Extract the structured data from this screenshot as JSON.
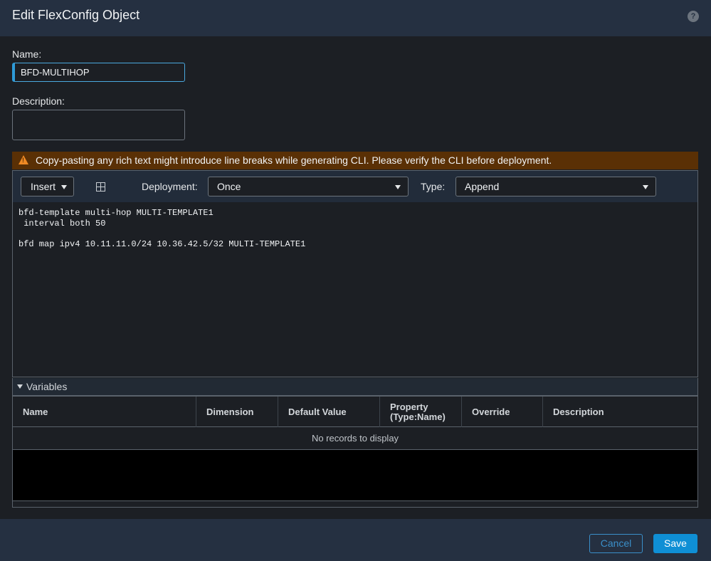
{
  "dialog": {
    "title": "Edit FlexConfig Object",
    "help_icon": "question-circle-icon",
    "help_glyph": "?"
  },
  "form": {
    "name_label": "Name:",
    "name_value": "BFD-MULTIHOP",
    "description_label": "Description:",
    "description_value": ""
  },
  "warning": {
    "icon": "warning-triangle-icon",
    "text": "Copy-pasting any rich text might introduce line breaks while generating CLI. Please verify the CLI before deployment."
  },
  "toolbar": {
    "insert_label": "Insert",
    "table_icon": "insert-table-icon",
    "deployment_label": "Deployment:",
    "deployment_value": "Once",
    "type_label": "Type:",
    "type_value": "Append"
  },
  "code": {
    "text": "bfd-template multi-hop MULTI-TEMPLATE1\n interval both 50\n\nbfd map ipv4 10.11.11.0/24 10.36.42.5/32 MULTI-TEMPLATE1"
  },
  "variables": {
    "section_label": "Variables",
    "columns": [
      "Name",
      "Dimension",
      "Default Value",
      "Property (Type:Name)",
      "Override",
      "Description"
    ],
    "empty_text": "No records to display"
  },
  "footer": {
    "cancel_label": "Cancel",
    "save_label": "Save"
  },
  "colors": {
    "accent": "#0f8fd5",
    "warning_bg": "#5a3005",
    "warning_icon": "#f08a24"
  }
}
